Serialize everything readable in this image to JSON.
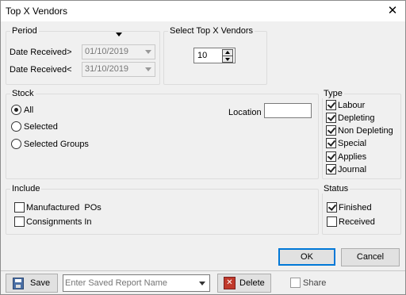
{
  "window": {
    "title": "Top X Vendors",
    "close_glyph": "✕"
  },
  "period": {
    "label": "Period",
    "date_from_label": "Date Received>",
    "date_from_value": "01/10/2019",
    "date_to_label": "Date Received<",
    "date_to_value": "31/10/2019"
  },
  "topx": {
    "label": "Select Top X Vendors",
    "value": "10"
  },
  "stock": {
    "label": "Stock",
    "options": [
      "All",
      "Selected",
      "Selected Groups"
    ],
    "selected": "All",
    "location_label": "Location",
    "location_value": ""
  },
  "type": {
    "label": "Type",
    "items": [
      {
        "label": "Labour",
        "checked": true
      },
      {
        "label": "Depleting",
        "checked": true
      },
      {
        "label": "Non Depleting",
        "checked": true
      },
      {
        "label": "Special",
        "checked": true
      },
      {
        "label": "Applies",
        "checked": true
      },
      {
        "label": "Journal",
        "checked": true
      }
    ]
  },
  "include": {
    "label": "Include",
    "items": [
      {
        "label": "Manufactured  POs",
        "checked": false
      },
      {
        "label": "Consignments In",
        "checked": false
      }
    ]
  },
  "status": {
    "label": "Status",
    "items": [
      {
        "label": "Finished",
        "checked": true
      },
      {
        "label": "Received",
        "checked": false
      }
    ]
  },
  "buttons": {
    "ok": "OK",
    "cancel": "Cancel"
  },
  "bottom": {
    "save": "Save",
    "report_placeholder": "Enter Saved Report Name",
    "delete": "Delete",
    "share": "Share",
    "share_checked": false
  },
  "colors": {
    "accent": "#0078d7",
    "delete_icon": "#c0392b"
  }
}
